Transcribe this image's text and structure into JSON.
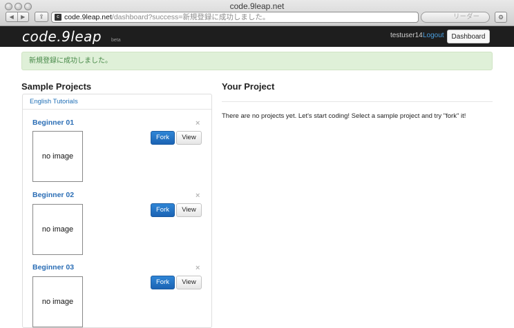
{
  "browser": {
    "window_title": "code.9leap.net",
    "nav_back": "◀",
    "nav_forward": "▶",
    "share_icon": "⇪",
    "url_host": "code.9leap.net",
    "url_path": "/dashboard?success=新規登録に成功しました。",
    "reader_label": "リーダー",
    "gear_icon": "⚙"
  },
  "navbar": {
    "logo": "code.9leap",
    "logo_beta": "beta",
    "user": "testuser14",
    "logout": "Logout",
    "dashboard": "Dashboard"
  },
  "alert": {
    "message": "新規登録に成功しました。",
    "color": "#dff0d8"
  },
  "sample_projects": {
    "title": "Sample Projects",
    "tab": "English Tutorials",
    "items": [
      {
        "title": "Beginner 01",
        "thumb": "no image",
        "fork": "Fork",
        "view": "View",
        "close": "×"
      },
      {
        "title": "Beginner 02",
        "thumb": "no image",
        "fork": "Fork",
        "view": "View",
        "close": "×"
      },
      {
        "title": "Beginner 03",
        "thumb": "no image",
        "fork": "Fork",
        "view": "View",
        "close": "×"
      }
    ]
  },
  "your_project": {
    "title": "Your Project",
    "empty_message": "There are no projects yet. Let's start coding! Select a sample project and try \"fork\" it!"
  },
  "colors": {
    "accent": "#1b63b4",
    "navbar": "#1e1e1e",
    "link": "#2a6db5"
  }
}
